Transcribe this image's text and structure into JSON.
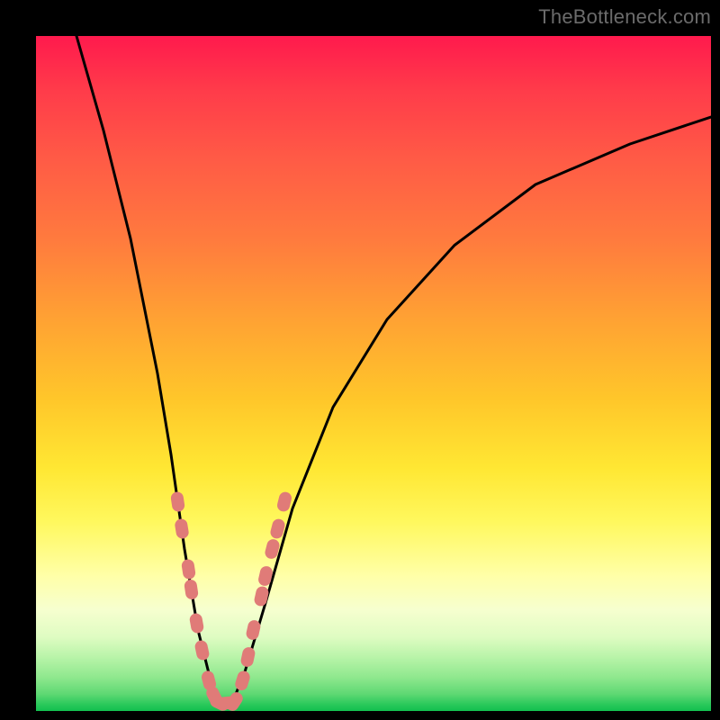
{
  "watermark": {
    "text": "TheBottleneck.com"
  },
  "colors": {
    "background": "#000000",
    "curve": "#000000",
    "marker_fill": "#e07b78",
    "marker_stroke": "#c9625f"
  },
  "chart_data": {
    "type": "line",
    "title": "",
    "xlabel": "",
    "ylabel": "",
    "xlim": [
      0,
      100
    ],
    "ylim": [
      0,
      100
    ],
    "grid": false,
    "note": "No axis ticks or labels are shown; values below are visual estimates on a 0–100 scale for each axis (y increases upward). The two black curves descend toward a near-zero minimum around x≈27 where a narrow green band lies, then the right curve rises again.",
    "series": [
      {
        "name": "left-curve",
        "values": [
          {
            "x": 6,
            "y": 100
          },
          {
            "x": 10,
            "y": 86
          },
          {
            "x": 14,
            "y": 70
          },
          {
            "x": 18,
            "y": 50
          },
          {
            "x": 20,
            "y": 38
          },
          {
            "x": 22,
            "y": 24
          },
          {
            "x": 24,
            "y": 12
          },
          {
            "x": 26,
            "y": 4
          },
          {
            "x": 27,
            "y": 1
          }
        ]
      },
      {
        "name": "right-curve",
        "values": [
          {
            "x": 29,
            "y": 1
          },
          {
            "x": 31,
            "y": 6
          },
          {
            "x": 34,
            "y": 16
          },
          {
            "x": 38,
            "y": 30
          },
          {
            "x": 44,
            "y": 45
          },
          {
            "x": 52,
            "y": 58
          },
          {
            "x": 62,
            "y": 69
          },
          {
            "x": 74,
            "y": 78
          },
          {
            "x": 88,
            "y": 84
          },
          {
            "x": 100,
            "y": 88
          }
        ]
      },
      {
        "name": "valley-floor",
        "values": [
          {
            "x": 27,
            "y": 1
          },
          {
            "x": 29,
            "y": 1
          }
        ]
      }
    ],
    "markers": {
      "name": "highlighted-points",
      "note": "Short pink bead-like markers clustered on both curve walls near the minimum and a few along the valley floor.",
      "points": [
        {
          "x": 21.0,
          "y": 31
        },
        {
          "x": 21.6,
          "y": 27
        },
        {
          "x": 22.6,
          "y": 21
        },
        {
          "x": 23.0,
          "y": 18
        },
        {
          "x": 23.8,
          "y": 13
        },
        {
          "x": 24.6,
          "y": 9
        },
        {
          "x": 25.6,
          "y": 4.5
        },
        {
          "x": 26.4,
          "y": 2.2
        },
        {
          "x": 27.2,
          "y": 1.2
        },
        {
          "x": 28.4,
          "y": 1.2
        },
        {
          "x": 29.4,
          "y": 1.4
        },
        {
          "x": 30.6,
          "y": 4.5
        },
        {
          "x": 31.4,
          "y": 8
        },
        {
          "x": 32.2,
          "y": 12
        },
        {
          "x": 33.4,
          "y": 17
        },
        {
          "x": 34.0,
          "y": 20
        },
        {
          "x": 35.0,
          "y": 24
        },
        {
          "x": 35.8,
          "y": 27
        },
        {
          "x": 36.8,
          "y": 31
        }
      ]
    }
  }
}
